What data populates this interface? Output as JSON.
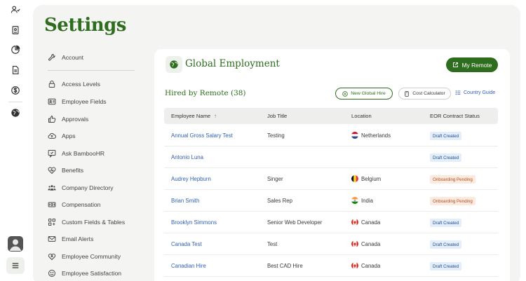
{
  "page": {
    "title": "Settings"
  },
  "rail": {
    "icons": [
      "people-icon",
      "id-badge-icon",
      "pie-chart-icon",
      "document-icon",
      "dollar-icon",
      "globe-icon"
    ]
  },
  "nav": {
    "items": [
      {
        "label": "Account",
        "icon": "wrench-icon"
      },
      {
        "label": "Access Levels",
        "icon": "lock-icon"
      },
      {
        "label": "Employee Fields",
        "icon": "id-card-icon"
      },
      {
        "label": "Approvals",
        "icon": "thumbs-up-icon"
      },
      {
        "label": "Apps",
        "icon": "cloud-icon"
      },
      {
        "label": "Ask BambooHR",
        "icon": "chat-icon"
      },
      {
        "label": "Benefits",
        "icon": "heart-icon"
      },
      {
        "label": "Company Directory",
        "icon": "group-icon"
      },
      {
        "label": "Compensation",
        "icon": "money-icon"
      },
      {
        "label": "Custom Fields & Tables",
        "icon": "grid-icon"
      },
      {
        "label": "Email Alerts",
        "icon": "mail-icon"
      },
      {
        "label": "Employee Community",
        "icon": "community-icon"
      },
      {
        "label": "Employee Satisfaction",
        "icon": "smile-icon"
      }
    ]
  },
  "card": {
    "title": "Global Employment",
    "my_remote": "My Remote",
    "hired_title": "Hired by Remote (38)",
    "new_hire": "New Global Hire",
    "cost_calc": "Cost Calculator",
    "country_guide": "Country Guide",
    "columns": {
      "name": "Employee Name",
      "job": "Job Title",
      "location": "Location",
      "status": "EOR Contract Status"
    },
    "rows": [
      {
        "name": "Annual Gross Salary Test",
        "job": "Testing",
        "location": "Netherlands",
        "flag": "nl",
        "status": "Draft Created",
        "status_kind": "draft"
      },
      {
        "name": "Antonio Luna",
        "job": "",
        "location": "",
        "flag": "",
        "status": "Draft Created",
        "status_kind": "draft"
      },
      {
        "name": "Audrey Hepburn",
        "job": "Singer",
        "location": "Belgium",
        "flag": "be",
        "status": "Onboarding Pending",
        "status_kind": "onb"
      },
      {
        "name": "Brian Smith",
        "job": "Sales Rep",
        "location": "India",
        "flag": "in",
        "status": "Onboarding Pending",
        "status_kind": "onb"
      },
      {
        "name": "Brooklyn Simmons",
        "job": "Senior Web Developer",
        "location": "Canada",
        "flag": "ca",
        "status": "Draft Created",
        "status_kind": "draft"
      },
      {
        "name": "Canada Test",
        "job": "Test",
        "location": "Canada",
        "flag": "ca",
        "status": "Draft Created",
        "status_kind": "draft"
      },
      {
        "name": "Canadian Hire",
        "job": "Best CAD Hire",
        "location": "Canada",
        "flag": "ca",
        "status": "Draft Created",
        "status_kind": "draft"
      }
    ]
  },
  "colors": {
    "brand_green": "#2e6d1e",
    "link_blue": "#2f5fb3"
  }
}
